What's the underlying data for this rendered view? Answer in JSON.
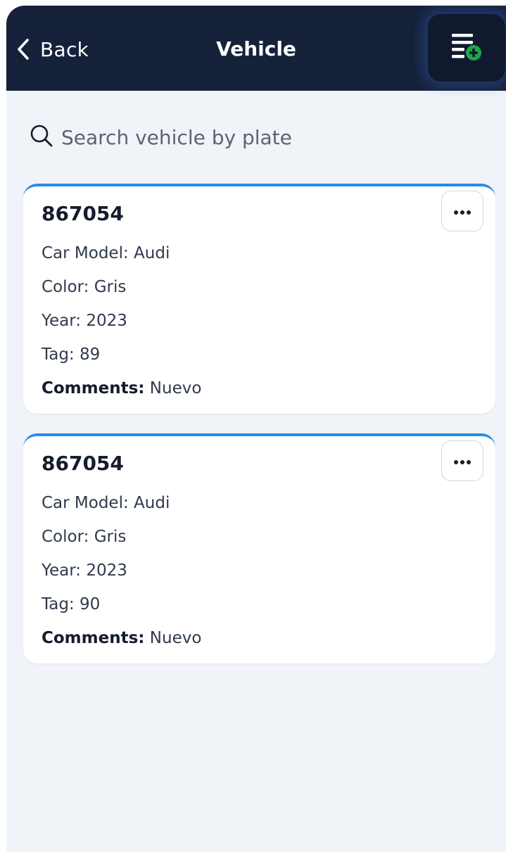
{
  "header": {
    "back_label": "Back",
    "title": "Vehicle",
    "back_icon": "chevron-left-icon",
    "add_icon": "list-add-icon"
  },
  "search": {
    "placeholder": "Search vehicle by plate",
    "value": "",
    "icon": "search-icon"
  },
  "vehicles": [
    {
      "plate": "867054",
      "model_label": "Car Model:",
      "model": "Audi",
      "color_label": "Color:",
      "color": "Gris",
      "year_label": "Year:",
      "year": "2023",
      "tag_label": "Tag:",
      "tag": "89",
      "comments_label": "Comments:",
      "comments": "Nuevo"
    },
    {
      "plate": "867054",
      "model_label": "Car Model:",
      "model": "Audi",
      "color_label": "Color:",
      "color": "Gris",
      "year_label": "Year:",
      "year": "2023",
      "tag_label": "Tag:",
      "tag": "90",
      "comments_label": "Comments:",
      "comments": "Nuevo"
    }
  ],
  "colors": {
    "header_bg": "#16223a",
    "accent": "#2a8be6",
    "add_plus": "#1fa64a",
    "background": "#f0f4f8"
  }
}
